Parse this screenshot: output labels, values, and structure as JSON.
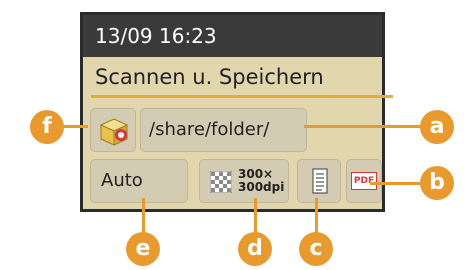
{
  "panel": {
    "datetime": "13/09 16:23",
    "function_title": "Scannen u. Speichern",
    "destination_path": "/share/folder/",
    "color_mode": "Auto",
    "resolution_line1": "300×",
    "resolution_line2": "300dpi",
    "file_format": "PDF"
  },
  "callouts": {
    "a": "a",
    "b": "b",
    "c": "c",
    "d": "d",
    "e": "e",
    "f": "f"
  },
  "icons": {
    "storage": "storage-box-icon",
    "resolution": "checker-pattern-icon",
    "orientation": "document-orientation-icon",
    "pdf": "pdf-icon"
  },
  "colors": {
    "screen_bg": "#e1d6ac",
    "title_bg": "#3a3a3a",
    "accent": "#e89a2e",
    "rule": "#d7b530",
    "pdf_red": "#d9363e"
  }
}
